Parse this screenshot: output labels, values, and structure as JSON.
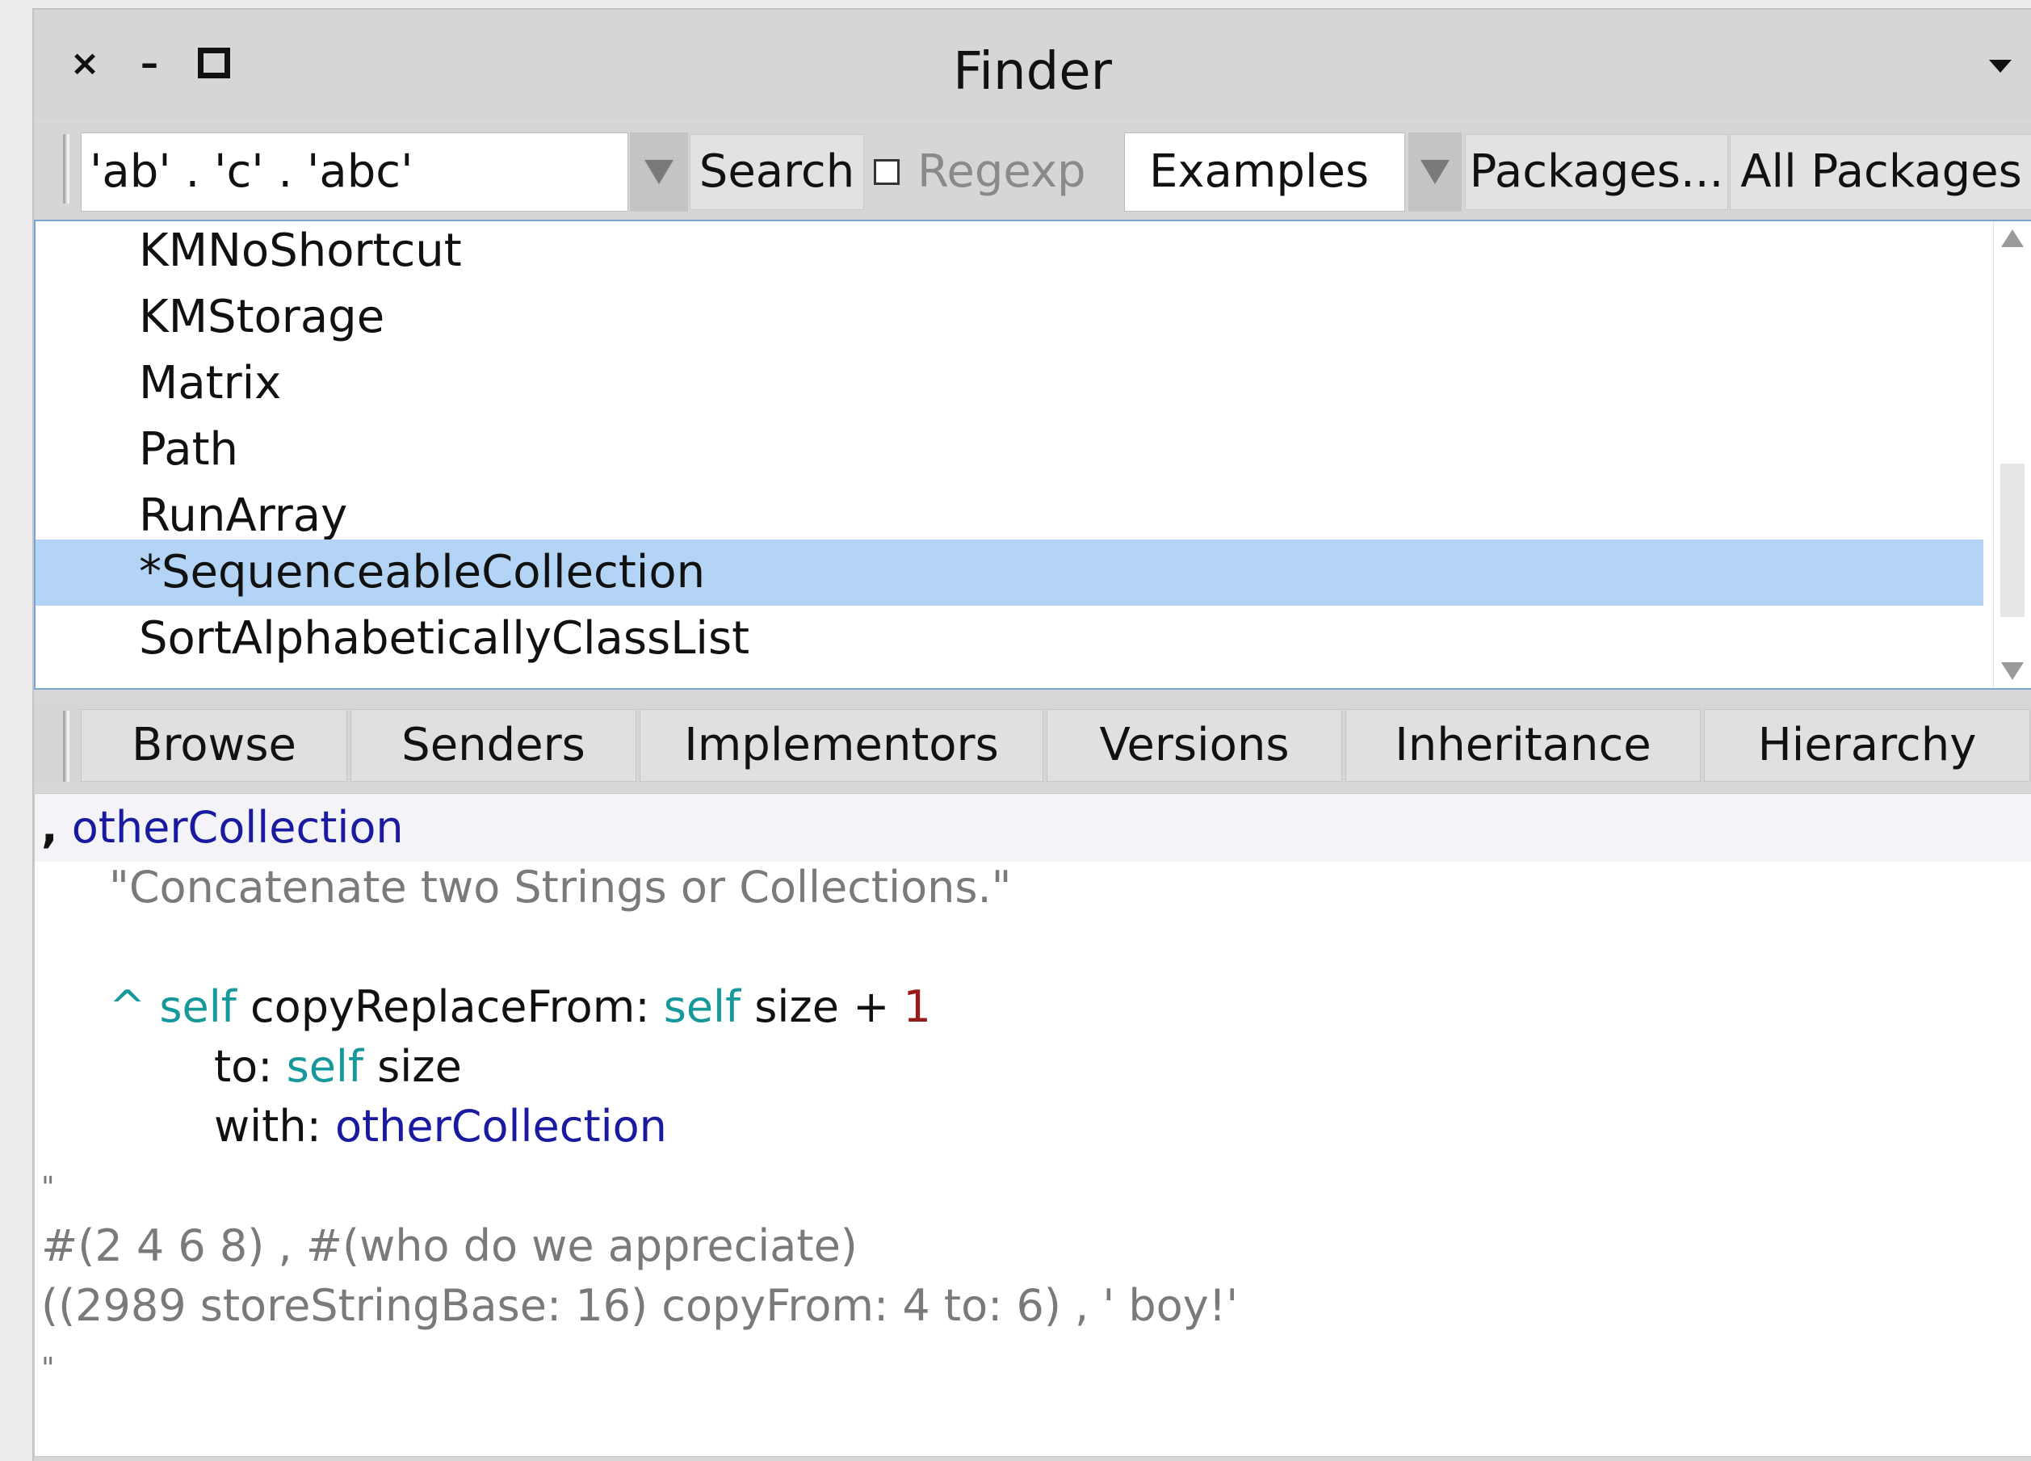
{
  "window": {
    "title": "Finder",
    "close_glyph": "×",
    "minimize_glyph": "–"
  },
  "toolbar": {
    "search_value": "'ab' . 'c' . 'abc'",
    "search_button": "Search",
    "regexp_label": "Regexp",
    "regexp_checked": false,
    "mode_selected": "Examples",
    "packages_button": "Packages...",
    "all_packages_button": "All Packages"
  },
  "results": {
    "items": [
      {
        "label": "KMNoShortcut",
        "selected": false
      },
      {
        "label": "KMStorage",
        "selected": false
      },
      {
        "label": "Matrix",
        "selected": false
      },
      {
        "label": "Path",
        "selected": false
      },
      {
        "label": "RunArray",
        "selected": false
      },
      {
        "label": "*SequenceableCollection",
        "selected": true
      },
      {
        "label": "SortAlphabeticallyClassList",
        "selected": false
      }
    ]
  },
  "actions": {
    "browse": "Browse",
    "senders": "Senders",
    "implementors": "Implementors",
    "versions": "Versions",
    "inheritance": "Inheritance",
    "hierarchy": "Hierarchy"
  },
  "code": {
    "sig_comma": ",",
    "sig_arg": "otherCollection",
    "comment": "\"Concatenate two Strings or Collections.\"",
    "ret": "^",
    "self1": "self",
    "msg1": "copyReplaceFrom:",
    "self2": "self",
    "size1": "size +",
    "num1": "1",
    "to_kw": "to:",
    "self3": "self",
    "size2": "size",
    "with_kw": "with:",
    "with_arg": "otherCollection",
    "quote_open": "\"",
    "example1": "#(2 4 6 8) , #(who do we appreciate)",
    "example2": "((2989 storeStringBase: 16) copyFrom: 4 to: 6) , ' boy!'",
    "quote_close": "\""
  },
  "colors": {
    "selection": "#b3d4f5",
    "list_border": "#7aa4d4",
    "selector_blue": "#1a1aa0",
    "self_teal": "#17989a",
    "number_red": "#9b1b1b",
    "comment_gray": "#7a7a7a"
  }
}
